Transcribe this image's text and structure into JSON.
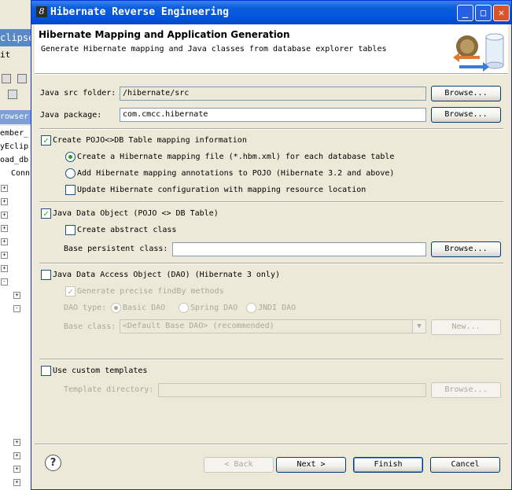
{
  "background_window": {
    "title_fragment": "clipse",
    "menu_fragment": "it",
    "view_tab_fragment": "rowser",
    "tree_rows": [
      "ember_",
      "yEclip",
      "oad_db",
      "Conn"
    ]
  },
  "dialog": {
    "title": "Hibernate Reverse Engineering",
    "header_title": "Hibernate Mapping and Application Generation",
    "header_desc": "Generate Hibernate mapping and Java classes from database explorer tables",
    "src_folder_label": "Java src folder:",
    "src_folder_value": "/hibernate/src",
    "package_label": "Java package:",
    "package_value": "com.cmcc.hibernate",
    "browse_label": "Browse...",
    "create_pojo_label": "Create POJO<>DB Table mapping information",
    "radio_mapping_file": "Create a Hibernate mapping file (*.hbm.xml) for each database table",
    "radio_annotations": "Add Hibernate mapping annotations to POJO (Hibernate 3.2 and above)",
    "update_config_label": "Update Hibernate configuration with mapping resource location",
    "java_data_object_label": "Java Data Object (POJO <> DB Table)",
    "abstract_class_label": "Create abstract class",
    "base_persistent_label": "Base persistent class:",
    "base_persistent_value": "",
    "dao_label": "Java Data Access Object (DAO) (Hibernate 3 only)",
    "precise_findby_label": "Generate precise findBy methods",
    "dao_type_label": "DAO type:",
    "dao_type_basic": "Basic DAO",
    "dao_type_spring": "Spring DAO",
    "dao_type_jndi": "JNDI DAO",
    "base_class_label": "Base class:",
    "base_class_value": "<Default Base DAO> (recommended)",
    "new_label": "New...",
    "custom_templates_label": "Use custom templates",
    "template_dir_label": "Template directory:",
    "template_dir_value": "",
    "back_label": "< Back",
    "next_label": "Next >",
    "finish_label": "Finish",
    "cancel_label": "Cancel",
    "help_glyph": "?"
  }
}
